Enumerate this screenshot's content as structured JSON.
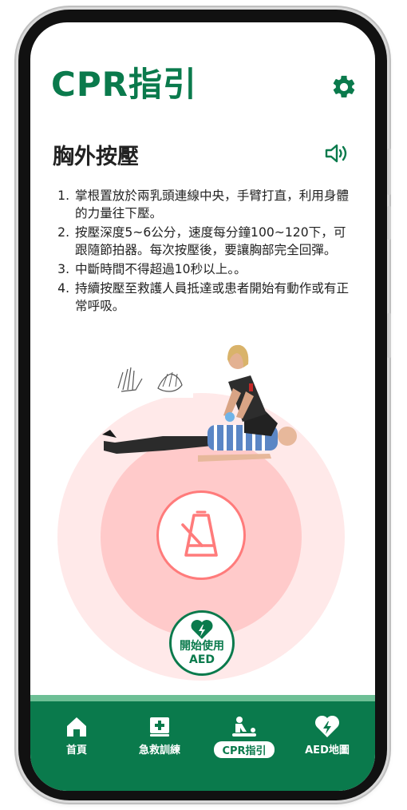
{
  "app": {
    "title": "CPR指引"
  },
  "section": {
    "title": "胸外按壓"
  },
  "steps": [
    "掌根置放於兩乳頭連線中央，手臂打直，利用身體的力量往下壓。",
    "按壓深度5~6公分，速度每分鐘100~120下，可跟隨節拍器。每次按壓後，要讓胸部完全回彈。",
    "中斷時間不得超過10秒以上。。",
    "持續按壓至救護人員抵達或患者開始有動作或有正常呼吸。"
  ],
  "aed_button": {
    "line1": "開始使用",
    "line2": "AED"
  },
  "nav": {
    "items": [
      {
        "label": "首頁",
        "icon": "home-icon",
        "active": false
      },
      {
        "label": "急救訓練",
        "icon": "first-aid-book-icon",
        "active": false
      },
      {
        "label": "CPR指引",
        "icon": "cpr-icon",
        "active": true
      },
      {
        "label": "AED地圖",
        "icon": "heart-bolt-icon",
        "active": false
      }
    ]
  },
  "icons": {
    "settings": "gear-icon",
    "audio": "speaker-icon",
    "metronome": "metronome-icon",
    "aed": "heart-bolt-icon"
  },
  "colors": {
    "brand_green": "#0a7a4c",
    "nav_strip": "#6dbf95",
    "metronome_red": "#ff7b7b",
    "ring_outer": "#ffe9e9",
    "ring_mid": "#ffcaca"
  }
}
